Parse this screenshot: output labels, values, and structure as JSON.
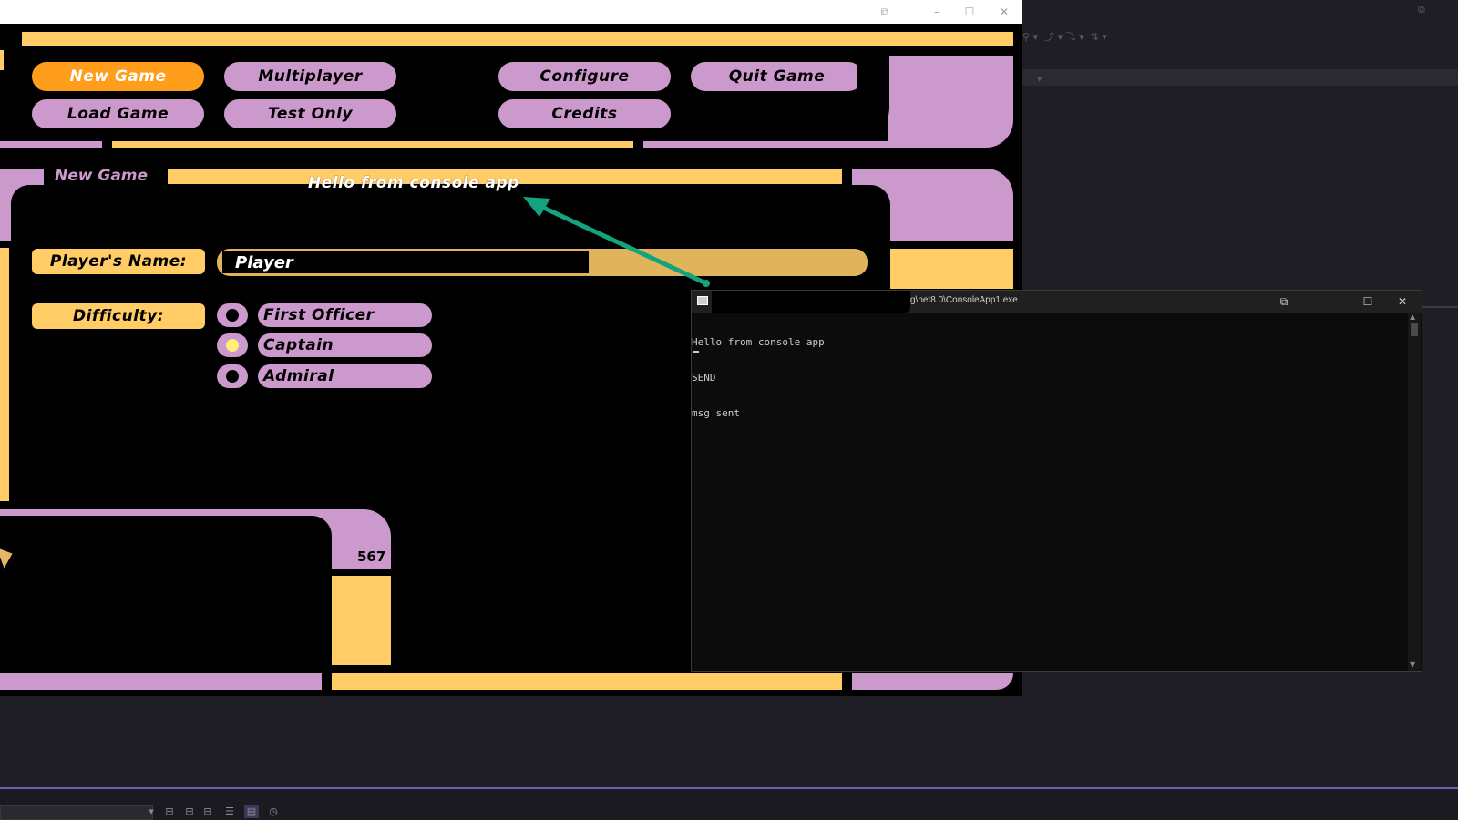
{
  "game": {
    "nav_buttons": {
      "new_game": "New Game",
      "multiplayer": "Multiplayer",
      "configure": "Configure",
      "quit_game": "Quit Game",
      "load_game": "Load Game",
      "test_only": "Test Only",
      "credits": "Credits"
    },
    "section_title": "New Game",
    "overlay_message": "Hello from console app",
    "player_name_label": "Player's Name:",
    "player_name_value": "Player",
    "difficulty_label": "Difficulty:",
    "difficulty_options": [
      "First Officer",
      "Captain",
      "Admiral"
    ],
    "difficulty_selected": "Captain",
    "counter": "567"
  },
  "console": {
    "title": "g\\net8.0\\ConsoleApp1.exe",
    "lines": [
      "Hello from console app",
      "SEND",
      "msg sent"
    ]
  },
  "colors": {
    "lcars_gold": "#ffcc66",
    "lcars_lilac": "#cc99cc",
    "lcars_orange_active": "#ff9e1b",
    "arrow_teal": "#14a37f",
    "console_bg": "#0c0c0c",
    "ide_bg": "#1f1e24",
    "ide_accent": "#6b5fb5"
  },
  "icons": {
    "console_app_icon": "console-window-icon",
    "minimize": "minimize-icon",
    "maximize": "maximize-icon",
    "close": "close-icon"
  }
}
